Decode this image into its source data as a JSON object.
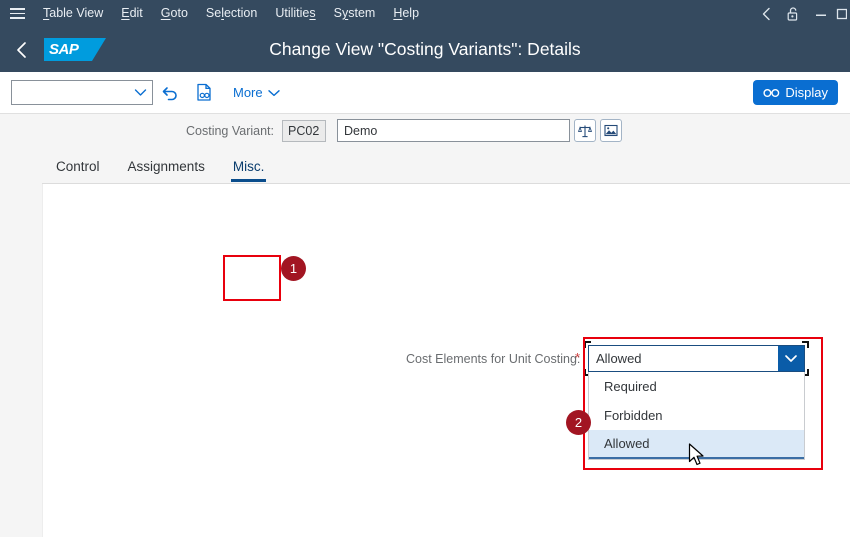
{
  "menubar": {
    "burger_icon": "hamburger-menu-icon",
    "items": [
      {
        "label": "Table View",
        "accel": "T"
      },
      {
        "label": "Edit",
        "accel": "E"
      },
      {
        "label": "Goto",
        "accel": "G"
      },
      {
        "label": "Selection",
        "accel": "l"
      },
      {
        "label": "Utilities",
        "accel": "s"
      },
      {
        "label": "System",
        "accel": "y"
      },
      {
        "label": "Help",
        "accel": "H"
      }
    ],
    "right_icons": [
      {
        "name": "back-chevron-icon"
      },
      {
        "name": "unlock-icon"
      },
      {
        "name": "minimize-icon"
      },
      {
        "name": "maximize-icon"
      }
    ]
  },
  "shellbar": {
    "back_icon": "back-chevron-icon",
    "logo_text": "SAP",
    "title": "Change View \"Costing Variants\": Details"
  },
  "toolbar": {
    "combo_value": "",
    "combo_placeholder": "",
    "back_icon": "undo-arrow-icon",
    "note_icon": "document-glasses-icon",
    "more_label": "More",
    "display_label": "Display",
    "display_icon": "glasses-icon"
  },
  "form": {
    "costing_variant_label": "Costing Variant:",
    "costing_variant_key": "PC02",
    "costing_variant_desc": "Demo",
    "scales_icon": "balance-scales-icon",
    "image_icon": "picture-icon"
  },
  "tabs": [
    {
      "label": "Control",
      "active": false
    },
    {
      "label": "Assignments",
      "active": false
    },
    {
      "label": "Misc.",
      "active": true
    }
  ],
  "field": {
    "label": "Cost Elements for Unit Costing:",
    "required_marker": "*",
    "value": "Allowed",
    "arrow_icon": "chevron-down-icon",
    "options": [
      {
        "label": "Required",
        "selected": false
      },
      {
        "label": "Forbidden",
        "selected": false
      },
      {
        "label": "Allowed",
        "selected": true
      }
    ]
  },
  "annotations": [
    {
      "badge": "1",
      "target": "misc-tab"
    },
    {
      "badge": "2",
      "target": "dropdown-list"
    }
  ],
  "colors": {
    "header_bg": "#354a5f",
    "sap_blue": "#009cde",
    "accent_blue": "#0a6ed1",
    "annotation_red": "#e8000d",
    "badge_red": "#a21522",
    "selected_row": "#dbe9f7"
  }
}
